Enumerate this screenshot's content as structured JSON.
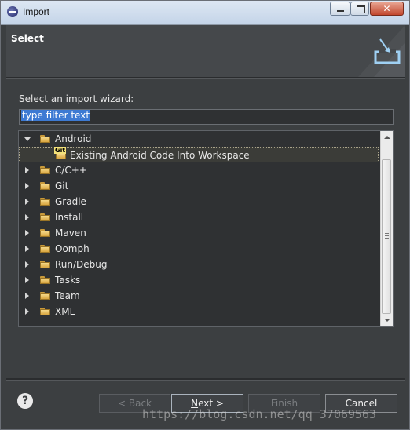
{
  "window": {
    "title": "Import"
  },
  "header": {
    "title": "Select"
  },
  "content": {
    "prompt": "Select an import wizard:",
    "filter": {
      "value": "type filter text"
    }
  },
  "tree": {
    "items": [
      {
        "label": "Android",
        "expanded": true
      },
      {
        "label": "Existing Android Code Into Workspace",
        "child": true,
        "selected": true
      },
      {
        "label": "C/C++"
      },
      {
        "label": "Git"
      },
      {
        "label": "Gradle"
      },
      {
        "label": "Install"
      },
      {
        "label": "Maven"
      },
      {
        "label": "Oomph"
      },
      {
        "label": "Run/Debug"
      },
      {
        "label": "Tasks"
      },
      {
        "label": "Team"
      },
      {
        "label": "XML"
      }
    ],
    "child_badge": "Git"
  },
  "footer": {
    "help": "?",
    "back": "< Back",
    "next_mnemonic": "N",
    "next_rest": "ext >",
    "finish": "Finish",
    "cancel": "Cancel"
  },
  "watermark": "https://blog.csdn.net/qq_37069563",
  "colors": {
    "background": "#3c3f41",
    "selection": "#3d7ad3",
    "titlebar": "#c4d4e8"
  }
}
